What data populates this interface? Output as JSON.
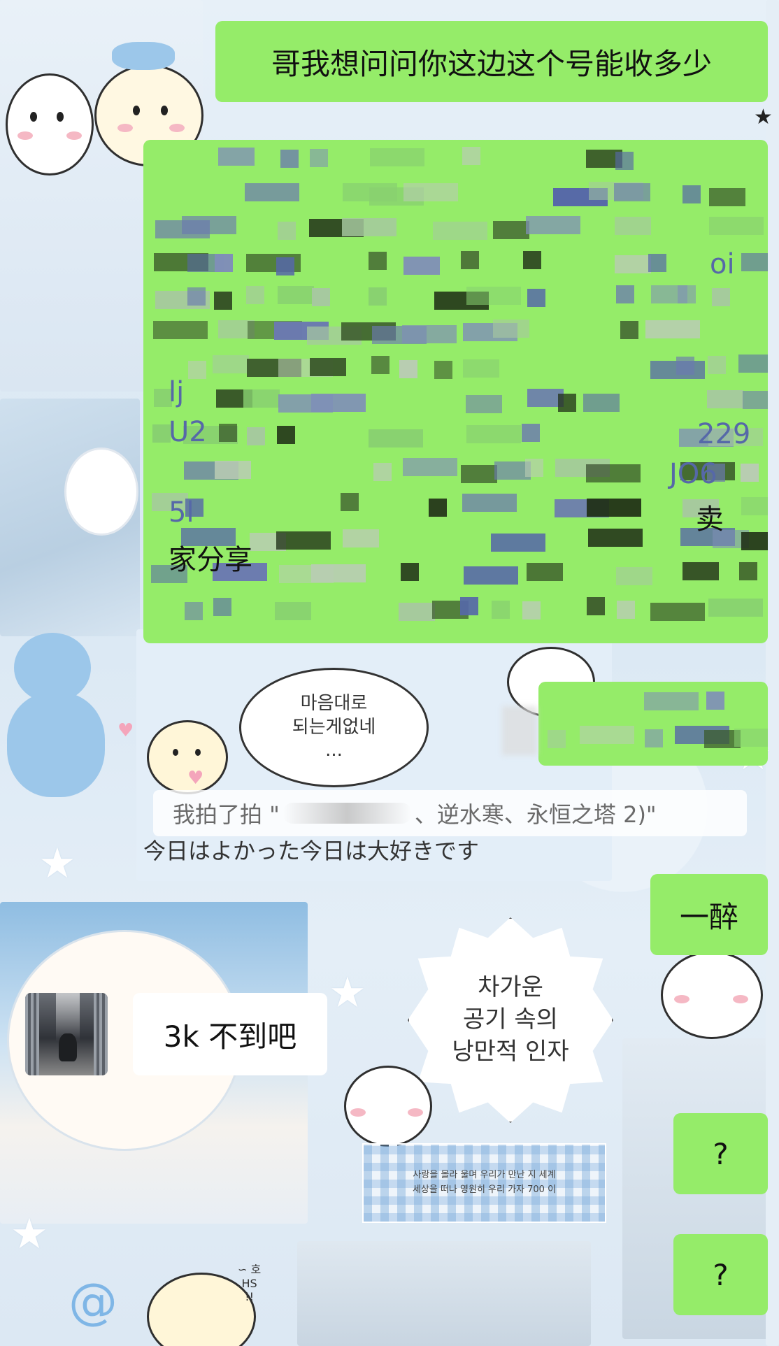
{
  "messages": {
    "m1": "哥我想问问你这边这个号能收多少",
    "m2_line_a": "家分享",
    "m2_frag_1": "lj",
    "m2_frag_2": "U2",
    "m2_frag_3": "JO6",
    "m2_frag_4": "卖",
    "m2_frag_5": "5l",
    "m2_frag_6": "229",
    "m2_frag_7": "oi",
    "m3_pat": "我拍了拍 \"",
    "m3_pat_end": "、逆水寒、永恒之塔 2)\"",
    "m4": "一醉",
    "m5": "3k 不到吧",
    "m6": "?",
    "m7": "?"
  },
  "wallpaper": {
    "korean_bubble_1": "마음대로\n되는게없네\n...",
    "japanese_line": "今日はよかった今日は大好きです",
    "korean_badge": "차가운\n공기 속의\n낭만적 인자",
    "checker_line_1": "사랑을 몰라 울며 우리가 만난 지 세계",
    "checker_line_2": "세상을 떠나 영원히 우리 가자 700 이",
    "small_note": "∽ 호\nHS\n!!"
  },
  "colors": {
    "my_bubble": "#95ec69",
    "their_bubble": "#ffffff",
    "wallpaper_base": "#dde9f4"
  },
  "icons": [
    "avatar-photo",
    "star-deco",
    "heart-deco",
    "spiral-deco"
  ]
}
